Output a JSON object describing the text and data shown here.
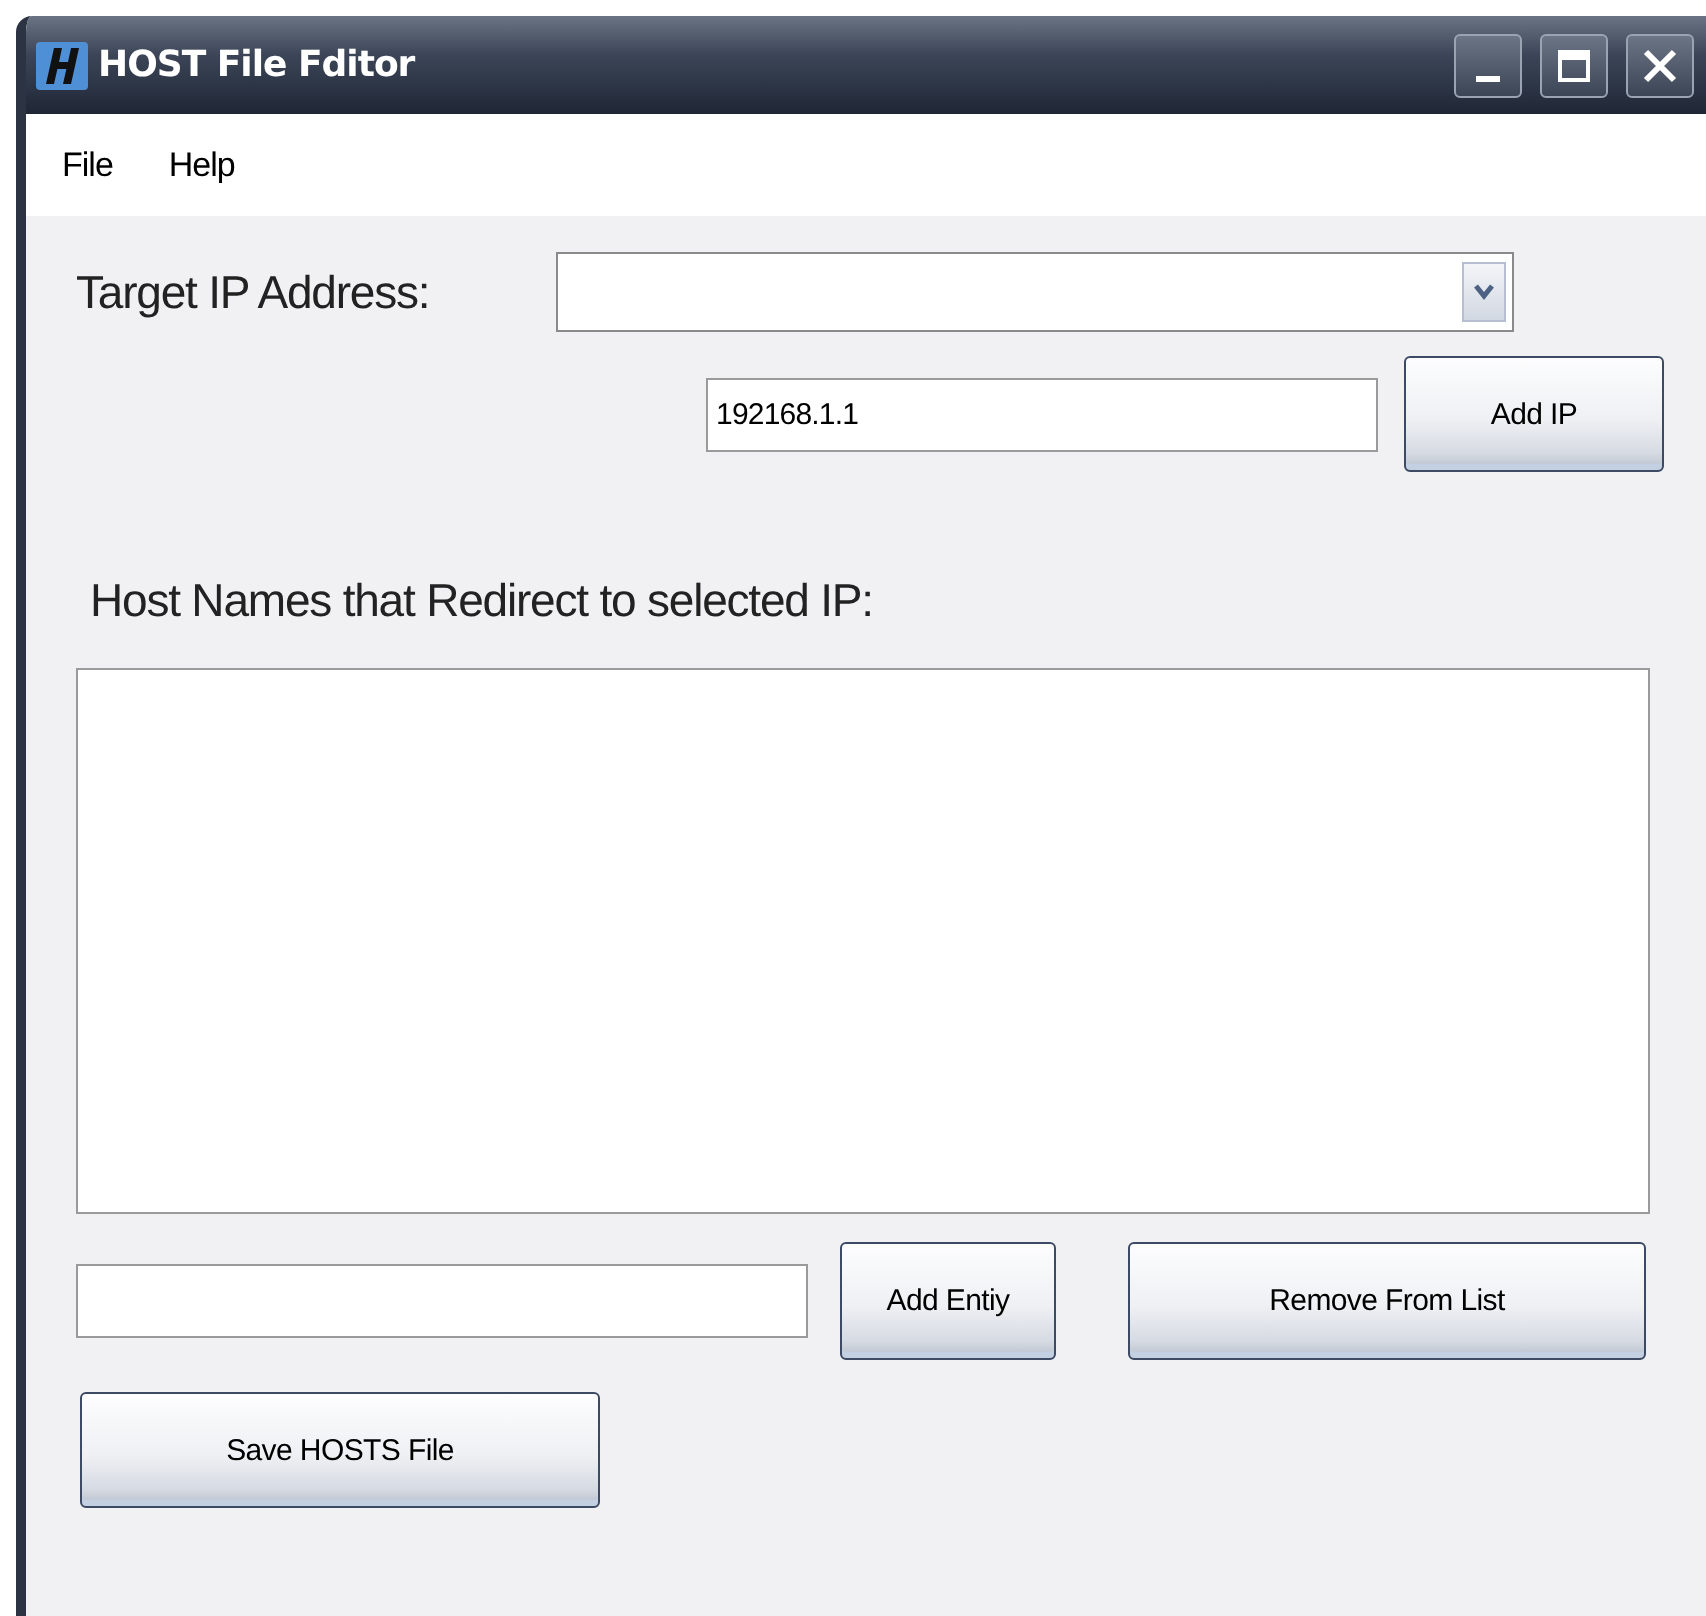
{
  "window": {
    "title": "HOST File Fditor"
  },
  "menu": [
    {
      "label": "File"
    },
    {
      "label": "Help"
    }
  ],
  "target": {
    "label": "Target IP Address:",
    "ip_value": "192168.1.1",
    "add_button": {
      "label": "Add IP"
    }
  },
  "hosts": {
    "label": "Host Names that Redirect to selected IP:",
    "add_button": {
      "label": "Add Entiy"
    },
    "remove_button": {
      "label": "Remove From List"
    }
  },
  "save_button": {
    "label": "Save HOSTS File"
  }
}
